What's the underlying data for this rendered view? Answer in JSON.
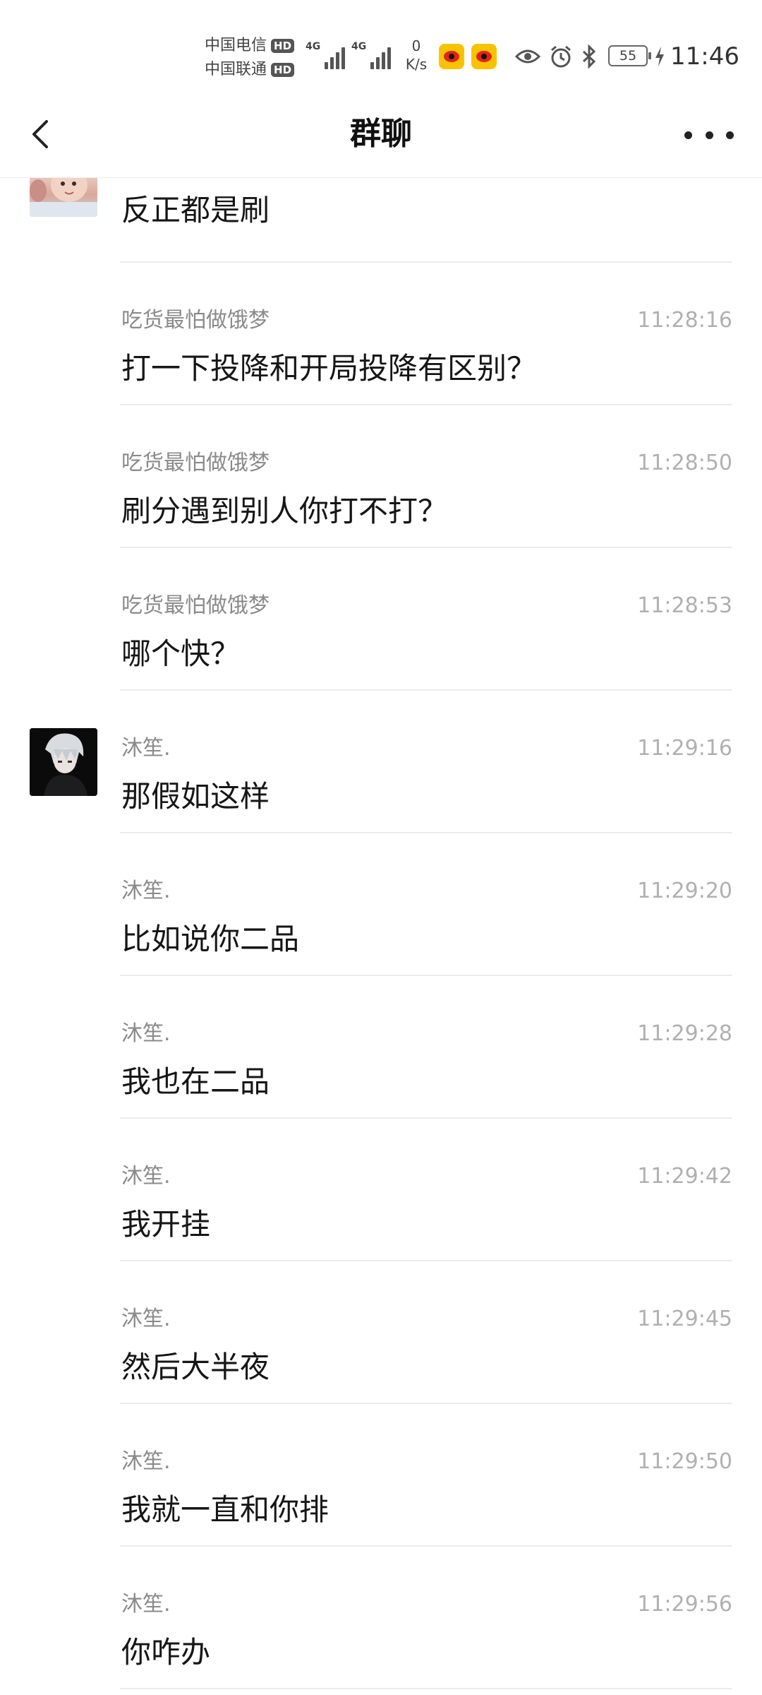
{
  "status_bar": {
    "carrier1": "中国电信",
    "carrier2": "中国联通",
    "hd": "HD",
    "network1": "4G",
    "network2": "4G",
    "speed_value": "0",
    "speed_unit": "K/s",
    "battery": "55",
    "time": "11:46"
  },
  "nav": {
    "title": "群聊"
  },
  "messages": [
    {
      "sender": "",
      "time": "",
      "text": "反正都是刷"
    },
    {
      "sender": "吃货最怕做饿梦",
      "time": "11:28:16",
      "text": "打一下投降和开局投降有区别？"
    },
    {
      "sender": "吃货最怕做饿梦",
      "time": "11:28:50",
      "text": "刷分遇到别人你打不打？"
    },
    {
      "sender": "吃货最怕做饿梦",
      "time": "11:28:53",
      "text": "哪个快？"
    },
    {
      "sender": "沐笙.",
      "time": "11:29:16",
      "text": "那假如这样"
    },
    {
      "sender": "沐笙.",
      "time": "11:29:20",
      "text": "比如说你二品"
    },
    {
      "sender": "沐笙.",
      "time": "11:29:28",
      "text": "我也在二品"
    },
    {
      "sender": "沐笙.",
      "time": "11:29:42",
      "text": "我开挂"
    },
    {
      "sender": "沐笙.",
      "time": "11:29:45",
      "text": "然后大半夜"
    },
    {
      "sender": "沐笙.",
      "time": "11:29:50",
      "text": "我就一直和你排"
    },
    {
      "sender": "沐笙.",
      "time": "11:29:56",
      "text": "你咋办"
    }
  ],
  "colors": {
    "divider": "#ececec",
    "sender": "#8a8a8a",
    "time": "#b0b0b0",
    "text": "#161616"
  }
}
